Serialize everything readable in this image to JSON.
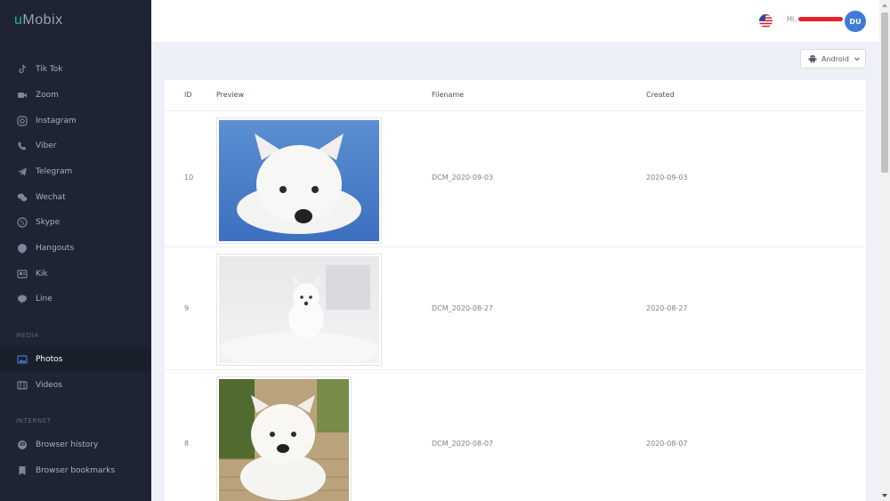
{
  "app": {
    "logo_u": "u",
    "logo_rest": "Mobix"
  },
  "sidebar": {
    "items": [
      {
        "label": "Tik Tok",
        "icon": "tiktok-icon"
      },
      {
        "label": "Zoom",
        "icon": "video-camera-icon"
      },
      {
        "label": "Instagram",
        "icon": "instagram-icon"
      },
      {
        "label": "Viber",
        "icon": "phone-icon"
      },
      {
        "label": "Telegram",
        "icon": "paper-plane-icon"
      },
      {
        "label": "Wechat",
        "icon": "chat-bubbles-icon"
      },
      {
        "label": "Skype",
        "icon": "skype-icon"
      },
      {
        "label": "Hangouts",
        "icon": "quote-bubble-icon"
      },
      {
        "label": "Kik",
        "icon": "newspaper-icon"
      },
      {
        "label": "Line",
        "icon": "speech-bubble-icon"
      }
    ],
    "media_label": "MEDIA",
    "media": [
      {
        "label": "Photos",
        "icon": "photos-icon"
      },
      {
        "label": "Videos",
        "icon": "film-icon"
      }
    ],
    "internet_label": "INTERNET",
    "internet": [
      {
        "label": "Browser history",
        "icon": "browser-icon"
      },
      {
        "label": "Browser bookmarks",
        "icon": "bookmark-icon"
      }
    ]
  },
  "header": {
    "greeting": "Hi,",
    "avatar_initials": "DU"
  },
  "device": {
    "label": "Android"
  },
  "table": {
    "headers": {
      "id": "ID",
      "preview": "Preview",
      "filename": "Filename",
      "created": "Created"
    },
    "rows": [
      {
        "id": "10",
        "filename": "DCM_2020-09-03",
        "created": "2020-09-03"
      },
      {
        "id": "9",
        "filename": "DCM_2020-08-27",
        "created": "2020-08-27"
      },
      {
        "id": "8",
        "filename": "DCM_2020-08-07",
        "created": "2020-08-07"
      }
    ]
  },
  "colors": {
    "sidebar_bg": "#1e2433",
    "accent": "#1fb89b",
    "avatar": "#3f7ad6",
    "redaction": "#e5242c"
  }
}
